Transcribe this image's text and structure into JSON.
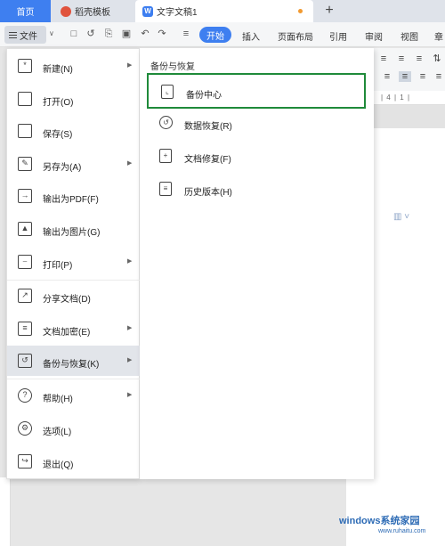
{
  "tabs": {
    "home": "首页",
    "templates": "稻壳模板",
    "document": "文字文稿1",
    "doc_icon": "W",
    "new_tab": "+"
  },
  "toolbar": {
    "file_label": "文件",
    "start_label": "开始",
    "items": [
      "插入",
      "页面布局",
      "引用",
      "审阅",
      "视图",
      "章"
    ]
  },
  "file_menu": {
    "items": [
      {
        "label": "新建(N)",
        "icon": "new-file-icon",
        "has_submenu": true
      },
      {
        "label": "打开(O)",
        "icon": "folder-open-icon",
        "has_submenu": false
      },
      {
        "label": "保存(S)",
        "icon": "save-icon",
        "has_submenu": false
      },
      {
        "label": "另存为(A)",
        "icon": "save-as-icon",
        "has_submenu": true
      },
      {
        "label": "输出为PDF(F)",
        "icon": "export-pdf-icon",
        "has_submenu": false
      },
      {
        "label": "输出为图片(G)",
        "icon": "export-image-icon",
        "has_submenu": false
      },
      {
        "label": "打印(P)",
        "icon": "print-icon",
        "has_submenu": true
      },
      {
        "label": "分享文档(D)",
        "icon": "share-icon",
        "has_submenu": false
      },
      {
        "label": "文档加密(E)",
        "icon": "encrypt-icon",
        "has_submenu": true
      },
      {
        "label": "备份与恢复(K)",
        "icon": "backup-restore-icon",
        "has_submenu": true,
        "active": true
      },
      {
        "label": "帮助(H)",
        "icon": "help-icon",
        "has_submenu": true
      },
      {
        "label": "选项(L)",
        "icon": "gear-icon",
        "has_submenu": false
      },
      {
        "label": "退出(Q)",
        "icon": "exit-icon",
        "has_submenu": false
      }
    ]
  },
  "submenu": {
    "title": "备份与恢复",
    "items": [
      {
        "label": "备份中心",
        "icon": "backup-center-icon",
        "highlighted": true
      },
      {
        "label": "数据恢复(R)",
        "icon": "data-recovery-icon"
      },
      {
        "label": "文档修复(F)",
        "icon": "document-repair-icon"
      },
      {
        "label": "历史版本(H)",
        "icon": "history-version-icon"
      }
    ]
  },
  "ruler": {
    "text": "| 4 | 1 |"
  },
  "watermark": {
    "main": "windows系统家园",
    "sub": "www.ruhaitu.com"
  },
  "colors": {
    "accent": "#3e7ff0",
    "highlight_border": "#1f8a3a",
    "menu_active": "#e2e5ea"
  }
}
